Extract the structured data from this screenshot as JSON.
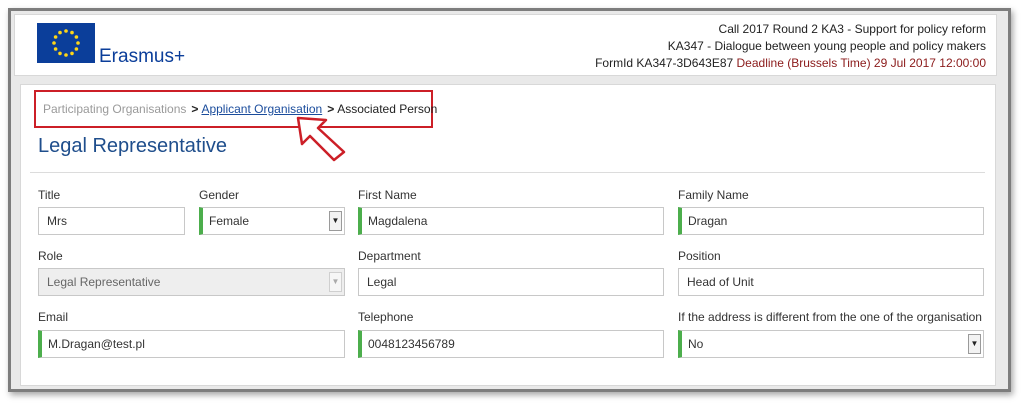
{
  "header": {
    "logo_text": "Erasmus+",
    "call_line": "Call 2017  Round 2  KA3 - Support for policy reform",
    "action_line": "KA347 - Dialogue between young people and policy makers",
    "form_id": "FormId KA347-3D643E87",
    "deadline": "Deadline (Brussels Time) 29 Jul 2017 12:00:00"
  },
  "breadcrumb": {
    "items": [
      {
        "label": "Participating Organisations"
      },
      {
        "label": "Applicant Organisation"
      },
      {
        "label": "Associated Person"
      }
    ]
  },
  "page_title": "Legal Representative",
  "form": {
    "title": {
      "label": "Title",
      "value": "Mrs"
    },
    "gender": {
      "label": "Gender",
      "value": "Female"
    },
    "first_name": {
      "label": "First Name",
      "value": "Magdalena"
    },
    "family_name": {
      "label": "Family Name",
      "value": "Dragan"
    },
    "role": {
      "label": "Role",
      "value": "Legal Representative"
    },
    "department": {
      "label": "Department",
      "value": "Legal"
    },
    "position": {
      "label": "Position",
      "value": "Head of Unit"
    },
    "email": {
      "label": "Email",
      "value": "M.Dragan@test.pl"
    },
    "telephone": {
      "label": "Telephone",
      "value": "0048123456789"
    },
    "address_different": {
      "label": "If the address is different from the one of the organisation",
      "value": "No"
    }
  },
  "icons": {
    "flag": "eu-flag-icon",
    "dropdown": "caret-down-icon",
    "pointer": "arrow-pointer-icon"
  },
  "colors": {
    "brand_blue": "#0b3e9a",
    "title_blue": "#1f4e8c",
    "highlight_red": "#cc1f27",
    "required_green": "#4cae4c",
    "deadline_red": "#8b1a1a"
  }
}
